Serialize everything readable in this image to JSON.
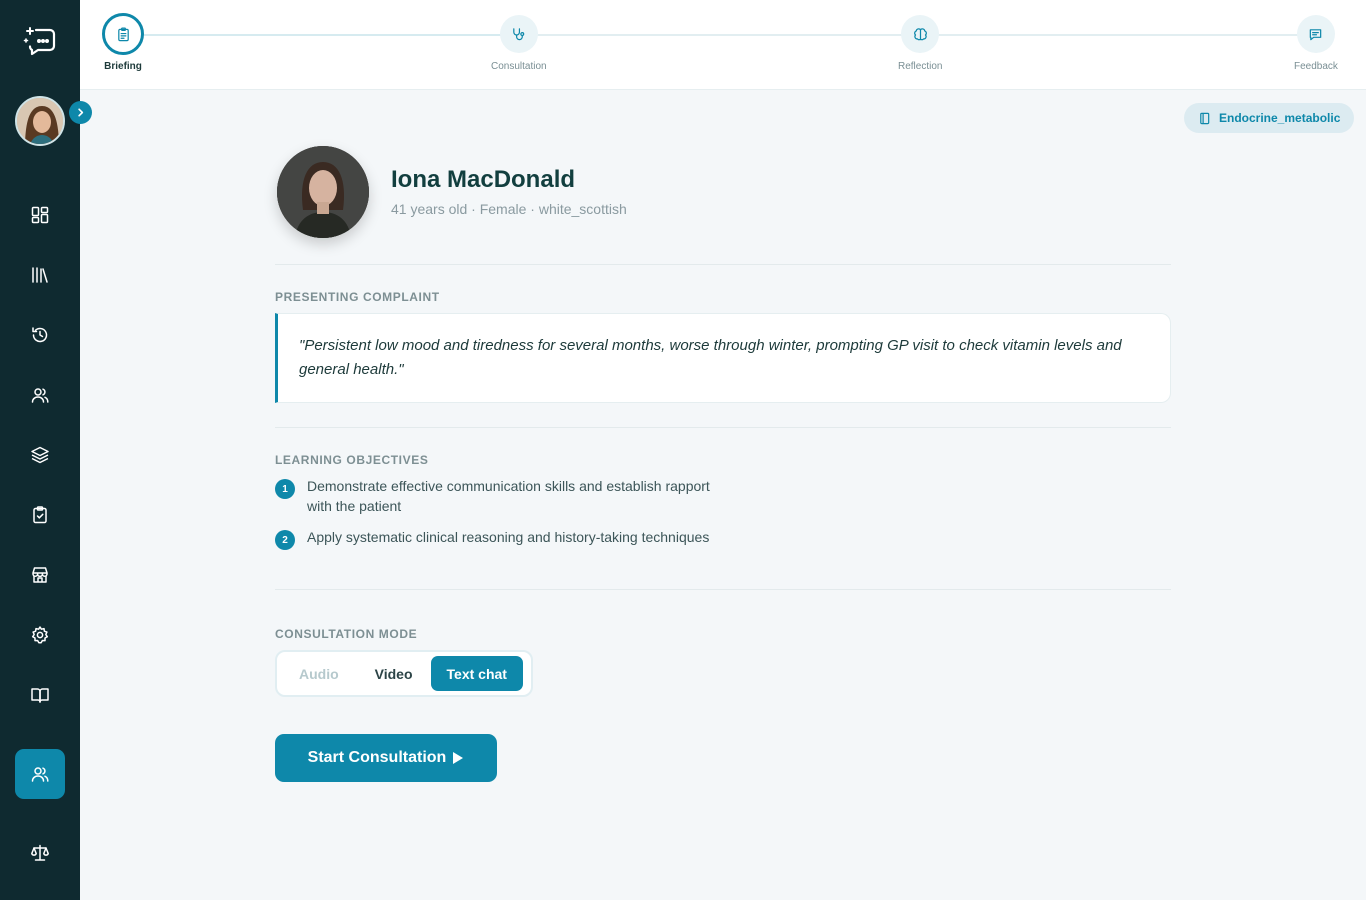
{
  "sidebar": {
    "logo_icon": "chat-sparkle-logo",
    "avatar_icon": "user-avatar",
    "expand_icon": "chevron-right-icon",
    "nav": [
      {
        "icon": "dashboard-grid-icon"
      },
      {
        "icon": "library-icon"
      },
      {
        "icon": "history-icon"
      },
      {
        "icon": "users-icon"
      },
      {
        "icon": "layers-icon"
      },
      {
        "icon": "clipboard-check-icon"
      },
      {
        "icon": "store-icon"
      },
      {
        "icon": "settings-gear-icon"
      },
      {
        "icon": "book-open-icon"
      },
      {
        "icon": "users-icon",
        "active": true
      },
      {
        "icon": "scales-icon"
      }
    ]
  },
  "stepper": {
    "steps": [
      {
        "label": "Briefing",
        "icon": "clipboard-icon",
        "active": true
      },
      {
        "label": "Consultation",
        "icon": "stethoscope-icon"
      },
      {
        "label": "Reflection",
        "icon": "brain-icon"
      },
      {
        "label": "Feedback",
        "icon": "message-icon"
      }
    ]
  },
  "tag": {
    "label": "Endocrine_metabolic",
    "icon": "notebook-icon"
  },
  "patient": {
    "name": "Iona MacDonald",
    "meta": "41 years old · Female · white_scottish",
    "photo_icon": "patient-portrait"
  },
  "presenting_complaint": {
    "label": "PRESENTING COMPLAINT",
    "text": "\"Persistent low mood and tiredness for several months, worse through winter, prompting GP visit to check vitamin levels and general health.\""
  },
  "learning_objectives": {
    "label": "LEARNING OBJECTIVES",
    "items": [
      {
        "num": "1",
        "text": "Demonstrate effective communication skills and establish rapport with the patient"
      },
      {
        "num": "2",
        "text": "Apply systematic clinical reasoning and history-taking techniques"
      }
    ]
  },
  "consultation_mode": {
    "label": "CONSULTATION MODE",
    "options": [
      "Audio",
      "Video",
      "Text chat"
    ],
    "selected": "Text chat"
  },
  "start_button": {
    "label": "Start Consultation",
    "icon": "play-icon"
  },
  "colors": {
    "accent": "#0e88aa",
    "sidebar": "#0f2a30",
    "background": "#f4f7f9"
  }
}
